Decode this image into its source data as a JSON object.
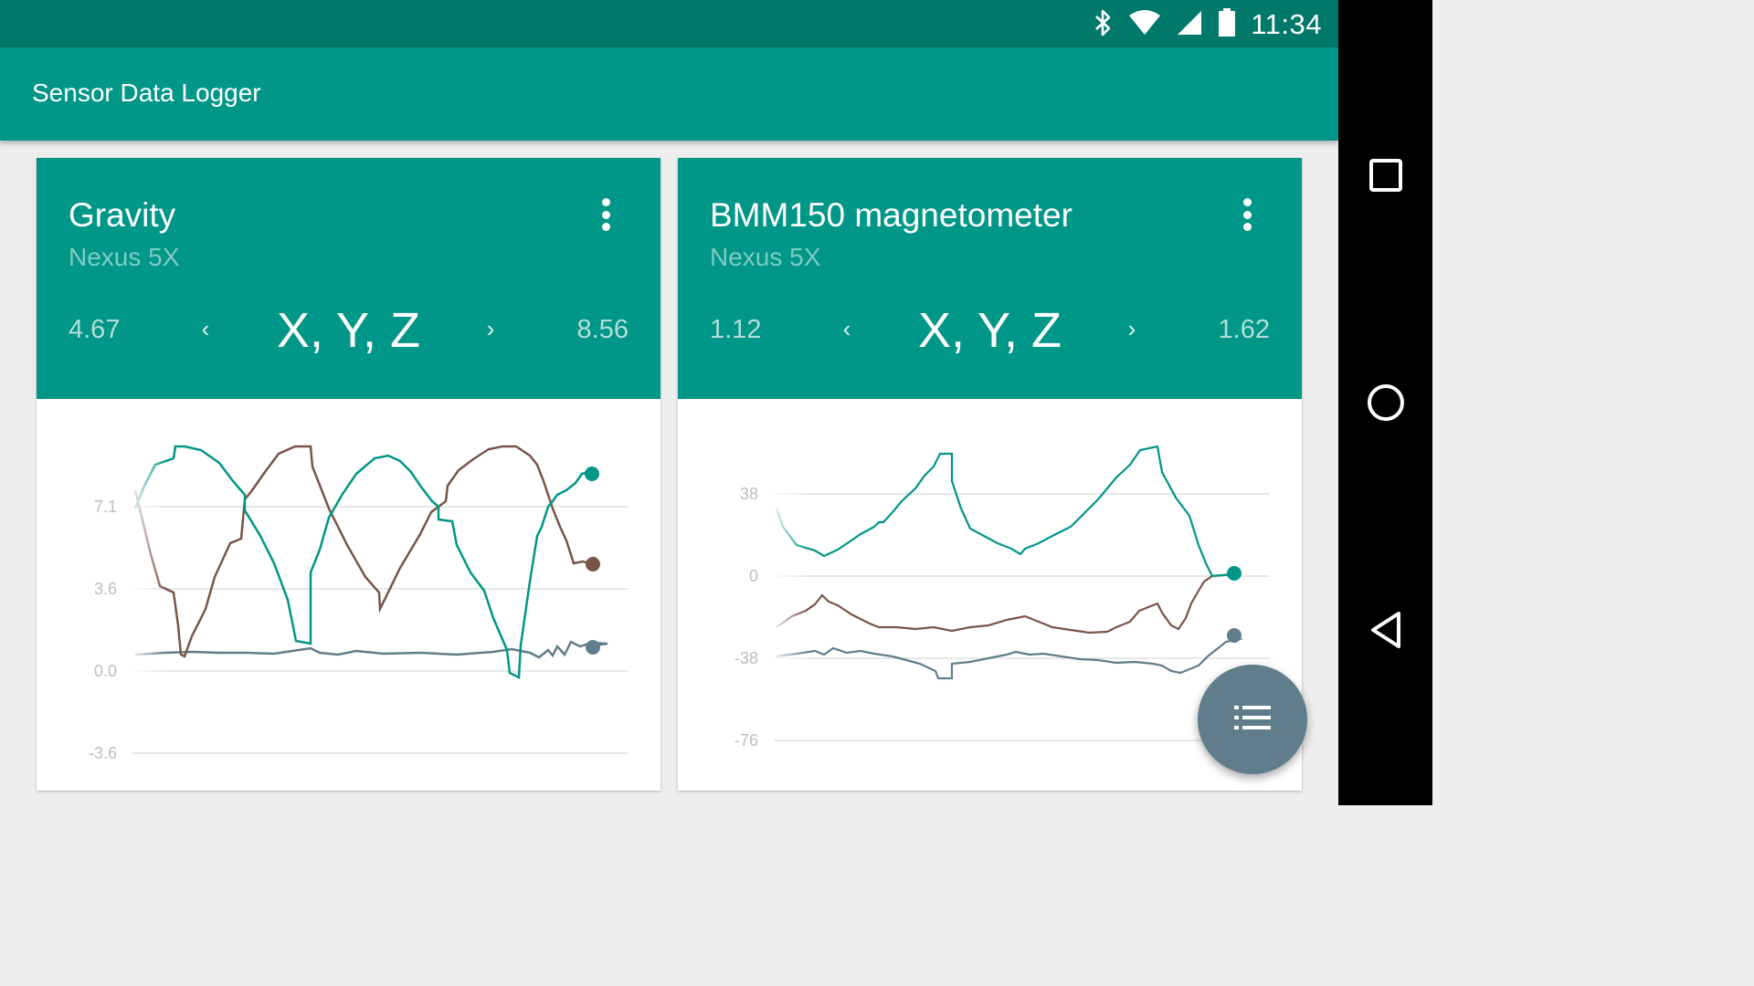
{
  "status_bar": {
    "time": "11:34",
    "icons": [
      "bluetooth-icon",
      "wifi-icon",
      "cellular-signal-icon",
      "battery-icon"
    ]
  },
  "app_bar": {
    "title": "Sensor Data Logger"
  },
  "cards": [
    {
      "title": "Gravity",
      "device": "Nexus 5X",
      "range_min": "4.67",
      "range_max": "8.56",
      "axes_label": "X, Y, Z",
      "prev_symbol": "‹",
      "next_symbol": "›",
      "y_ticks": [
        "7.1",
        "3.6",
        "0.0",
        "-3.6"
      ]
    },
    {
      "title": "BMM150 magnetometer",
      "device": "Nexus 5X",
      "range_min": "1.12",
      "range_max": "1.62",
      "axes_label": "X, Y, Z",
      "prev_symbol": "‹",
      "next_symbol": "›",
      "y_ticks": [
        "38",
        "0",
        "-38",
        "-76"
      ]
    }
  ],
  "colors": {
    "primary": "#009688",
    "primary_dark": "#00796b",
    "series_x": "#009688",
    "series_y": "#795548",
    "series_z": "#607d8b",
    "fab": "#607d8b"
  },
  "nav_bar": {
    "icons": [
      "recents-square-icon",
      "home-circle-icon",
      "back-triangle-icon"
    ]
  },
  "fab": {
    "icon": "list-icon"
  }
}
